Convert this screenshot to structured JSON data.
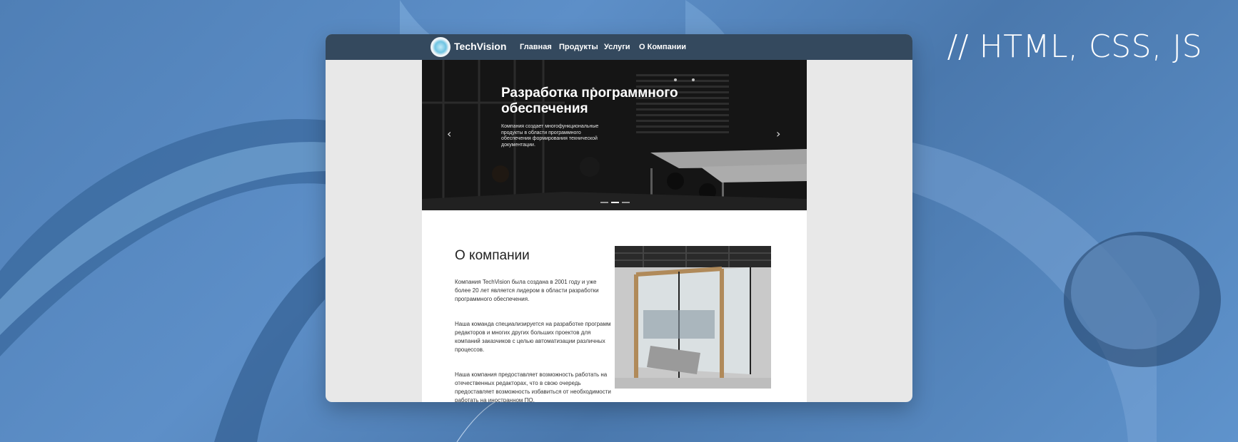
{
  "corner_label": "// HTML, CSS, JS",
  "site": {
    "brand": "TechVision",
    "nav": [
      {
        "label": "Главная"
      },
      {
        "label": "Продукты"
      },
      {
        "label": "Услуги"
      },
      {
        "label": "О Компании"
      }
    ]
  },
  "hero": {
    "title": "Разработка программного обеспечения",
    "text": "Компания создает многофункциональные продукты в области программного обеспечения формирования технической документации.",
    "prev_icon": "chevron-left-icon",
    "next_icon": "chevron-right-icon",
    "slides_count": 3,
    "active_slide": 2
  },
  "about": {
    "title": "О компании",
    "paragraphs": [
      "Компания TechVision была создана в 2001 году и уже более 20 лет является лидером в области разработки программного обеспечения.",
      "Наша команда специализируется на разработке программ редакторов и многих других больших проектов для компаний заказчиков с целью автоматизации различных процессов.",
      "Наша компания предоставляет возможность работать на отечественных редакторах, что в свою очередь предоставляет возможность избавиться от необходимости работать на иностранном ПО."
    ]
  },
  "colors": {
    "navbar": "#34495e",
    "page_background": "#e8e8e8"
  }
}
